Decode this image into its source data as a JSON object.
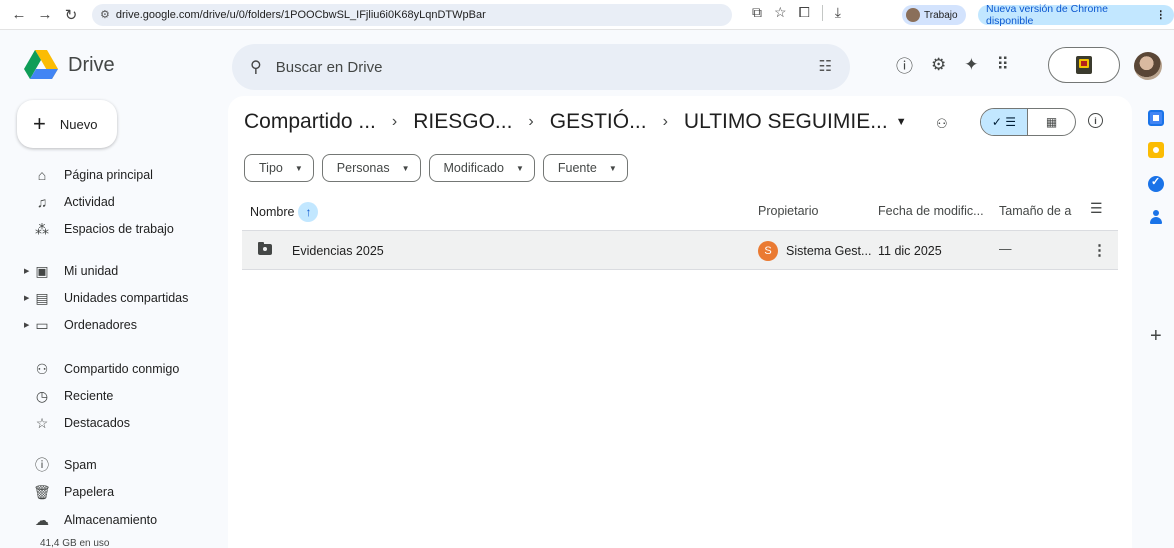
{
  "browser": {
    "url": "drive.google.com/drive/u/0/folders/1POOCbwSL_IFjliu6i0K68yLqnDTWpBar",
    "profile_label": "Trabajo",
    "update_label": "Nueva versión de Chrome disponible"
  },
  "app": {
    "name": "Drive",
    "search_placeholder": "Buscar en Drive"
  },
  "sidebar": {
    "new_label": "Nuevo",
    "items": [
      {
        "label": "Página principal",
        "icon": "home-icon"
      },
      {
        "label": "Actividad",
        "icon": "bell-icon"
      },
      {
        "label": "Espacios de trabajo",
        "icon": "workspaces-icon"
      },
      {
        "label": "Mi unidad",
        "icon": "my-drive-icon"
      },
      {
        "label": "Unidades compartidas",
        "icon": "shared-drives-icon"
      },
      {
        "label": "Ordenadores",
        "icon": "computer-icon"
      },
      {
        "label": "Compartido conmigo",
        "icon": "people-icon"
      },
      {
        "label": "Reciente",
        "icon": "clock-icon"
      },
      {
        "label": "Destacados",
        "icon": "star-icon"
      },
      {
        "label": "Spam",
        "icon": "spam-icon"
      },
      {
        "label": "Papelera",
        "icon": "trash-icon"
      },
      {
        "label": "Almacenamiento",
        "icon": "cloud-icon"
      }
    ],
    "storage_used": "41,4 GB en uso"
  },
  "breadcrumbs": [
    "Compartido ...",
    "RIESGO...",
    "GESTIÓ...",
    "ULTIMO SEGUIMIE..."
  ],
  "filters": [
    "Tipo",
    "Personas",
    "Modificado",
    "Fuente"
  ],
  "columns": {
    "name": "Nombre",
    "owner": "Propietario",
    "modified": "Fecha de modific...",
    "size": "Tamaño de a"
  },
  "rows": [
    {
      "name": "Evidencias 2025",
      "owner_initial": "S",
      "owner": "Sistema Gest...",
      "modified": "11 dic 2025",
      "size": "—"
    }
  ],
  "colors": {
    "accent": "#0b57d0",
    "selected_chip": "#c2e7ff",
    "owner_avatar": "#ea7a32"
  }
}
